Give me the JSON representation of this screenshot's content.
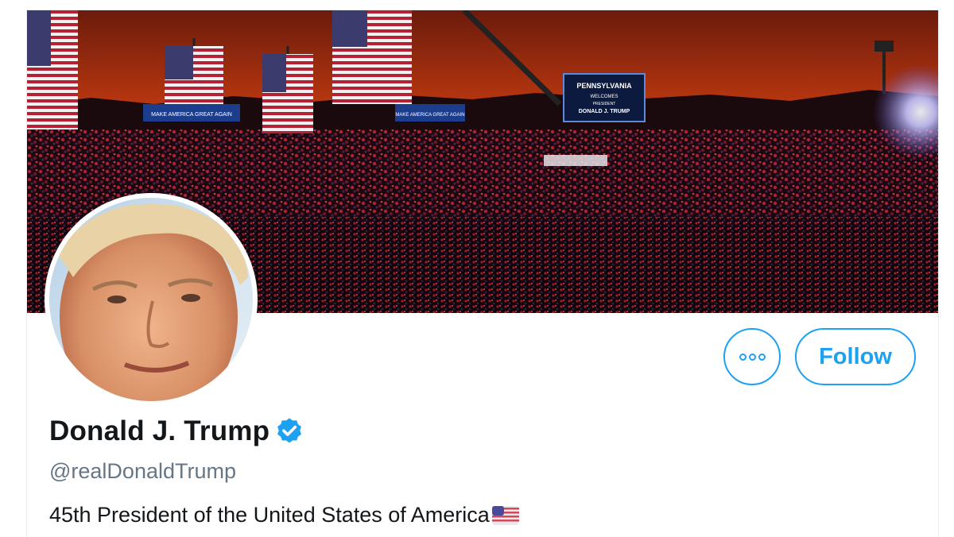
{
  "profile": {
    "display_name": "Donald J. Trump",
    "handle": "@realDonaldTrump",
    "bio": "45th President of the United States of America",
    "bio_emoji": "us-flag-emoji",
    "verified": true
  },
  "actions": {
    "more_label": "More",
    "follow_label": "Follow"
  },
  "banner": {
    "screen_line1": "PENNSYLVANIA",
    "screen_line2": "WELCOMES",
    "screen_line3": "PRESIDENT",
    "screen_line4": "DONALD J. TRUMP",
    "sign_left": "MAKE AMERICA GREAT AGAIN",
    "sign_mid": "MAKE AMERICA GREAT AGAIN"
  },
  "colors": {
    "accent": "#1da1f2",
    "name": "#14171a",
    "handle": "#657786"
  }
}
